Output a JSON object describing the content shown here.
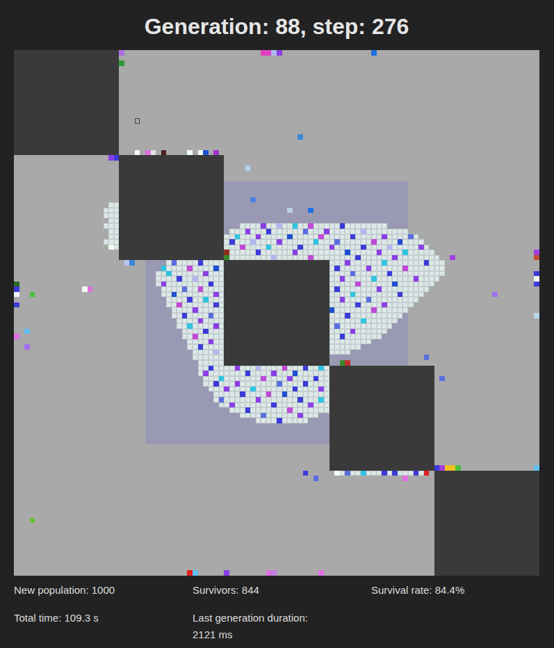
{
  "title": "Generation: 88, step: 276",
  "grid": {
    "size": 100,
    "obstacles": [
      [
        0,
        0,
        20,
        20
      ],
      [
        20,
        20,
        20,
        20
      ],
      [
        40,
        40,
        20,
        20
      ],
      [
        60,
        60,
        20,
        20
      ],
      [
        80,
        80,
        20,
        20
      ]
    ],
    "safe_zone": [
      25,
      25,
      50,
      50
    ],
    "marker": {
      "x": 23,
      "y": 13
    },
    "crowd": [
      [
        33,
        43,
        70
      ],
      [
        34,
        41,
        74
      ],
      [
        35,
        40,
        76
      ],
      [
        36,
        40,
        77
      ],
      [
        37,
        40,
        78
      ],
      [
        38,
        40,
        79
      ],
      [
        39,
        40,
        80
      ],
      [
        40,
        29,
        39
      ],
      [
        40,
        60,
        81
      ],
      [
        41,
        28,
        39
      ],
      [
        41,
        60,
        81
      ],
      [
        42,
        27,
        39
      ],
      [
        42,
        60,
        81
      ],
      [
        43,
        27,
        39
      ],
      [
        43,
        60,
        80
      ],
      [
        44,
        27,
        39
      ],
      [
        44,
        60,
        79
      ],
      [
        45,
        28,
        39
      ],
      [
        45,
        60,
        78
      ],
      [
        46,
        28,
        39
      ],
      [
        46,
        60,
        77
      ],
      [
        47,
        29,
        39
      ],
      [
        47,
        60,
        76
      ],
      [
        48,
        29,
        39
      ],
      [
        48,
        60,
        75
      ],
      [
        49,
        30,
        39
      ],
      [
        49,
        60,
        74
      ],
      [
        50,
        30,
        39
      ],
      [
        50,
        60,
        73
      ],
      [
        51,
        31,
        39
      ],
      [
        51,
        60,
        72
      ],
      [
        52,
        31,
        39
      ],
      [
        52,
        60,
        71
      ],
      [
        53,
        32,
        39
      ],
      [
        53,
        60,
        70
      ],
      [
        54,
        32,
        39
      ],
      [
        54,
        60,
        69
      ],
      [
        55,
        33,
        39
      ],
      [
        55,
        60,
        67
      ],
      [
        56,
        33,
        39
      ],
      [
        56,
        60,
        65
      ],
      [
        57,
        34,
        39
      ],
      [
        57,
        60,
        63
      ],
      [
        58,
        34,
        39
      ],
      [
        59,
        35,
        39
      ],
      [
        60,
        35,
        59
      ],
      [
        61,
        35,
        59
      ],
      [
        62,
        36,
        59
      ],
      [
        63,
        36,
        59
      ],
      [
        64,
        37,
        59
      ],
      [
        65,
        38,
        59
      ],
      [
        66,
        38,
        59
      ],
      [
        67,
        39,
        59
      ],
      [
        68,
        41,
        59
      ],
      [
        69,
        43,
        57
      ],
      [
        70,
        46,
        55
      ],
      [
        29,
        18,
        19
      ],
      [
        30,
        17,
        19
      ],
      [
        31,
        17,
        19
      ],
      [
        32,
        18,
        19
      ],
      [
        33,
        17,
        19
      ],
      [
        34,
        18,
        19
      ],
      [
        35,
        18,
        19
      ],
      [
        36,
        17,
        19
      ],
      [
        37,
        18,
        19
      ],
      [
        80,
        61,
        78
      ],
      [
        60,
        60,
        61
      ],
      [
        61,
        60,
        60
      ]
    ],
    "creatures": [
      [
        47,
        33,
        "#8a3fe6"
      ],
      [
        50,
        33,
        "#b0b8f0"
      ],
      [
        53,
        33,
        "#2fc4e0"
      ],
      [
        56,
        33,
        "#c04ad8"
      ],
      [
        62,
        33,
        "#3b3bd9"
      ],
      [
        44,
        34,
        "#8a3fe6"
      ],
      [
        48,
        34,
        "#3b3bd9"
      ],
      [
        55,
        34,
        "#5a6ee0"
      ],
      [
        59,
        34,
        "#8a3fe6"
      ],
      [
        66,
        34,
        "#b0b8f0"
      ],
      [
        42,
        35,
        "#2fc4e0"
      ],
      [
        46,
        35,
        "#8a3fe6"
      ],
      [
        52,
        35,
        "#1e4fd0"
      ],
      [
        58,
        35,
        "#c04ad8"
      ],
      [
        64,
        35,
        "#3b3bd9"
      ],
      [
        70,
        35,
        "#8a3fe6"
      ],
      [
        75,
        35,
        "#5a6ee0"
      ],
      [
        41,
        36,
        "#3b3bd9"
      ],
      [
        45,
        36,
        "#b0b8f0"
      ],
      [
        50,
        36,
        "#8a3fe6"
      ],
      [
        57,
        36,
        "#2fc4e0"
      ],
      [
        61,
        36,
        "#5a6ee0"
      ],
      [
        68,
        36,
        "#c04ad8"
      ],
      [
        73,
        36,
        "#1e4fd0"
      ],
      [
        43,
        37,
        "#c04ad8"
      ],
      [
        48,
        37,
        "#2fc4e0"
      ],
      [
        54,
        37,
        "#3b3bd9"
      ],
      [
        60,
        37,
        "#8a3fe6"
      ],
      [
        66,
        37,
        "#3b3bd9"
      ],
      [
        71,
        37,
        "#b0b8f0"
      ],
      [
        77,
        37,
        "#8a3fe6"
      ],
      [
        40,
        38,
        "#5a6ee0"
      ],
      [
        46,
        38,
        "#3b3bd9"
      ],
      [
        53,
        38,
        "#8a3fe6"
      ],
      [
        63,
        38,
        "#1e4fd0"
      ],
      [
        69,
        38,
        "#8a3fe6"
      ],
      [
        74,
        38,
        "#2fc4e0"
      ],
      [
        49,
        39,
        "#b0b8f0"
      ],
      [
        56,
        39,
        "#c04ad8"
      ],
      [
        65,
        39,
        "#3b3bd9"
      ],
      [
        72,
        39,
        "#8a3fe6"
      ],
      [
        30,
        40,
        "#5a6ee0"
      ],
      [
        35,
        40,
        "#3b3bd9"
      ],
      [
        63,
        40,
        "#8a3fe6"
      ],
      [
        70,
        40,
        "#2fc4e0"
      ],
      [
        78,
        40,
        "#3b3bd9"
      ],
      [
        33,
        41,
        "#c04ad8"
      ],
      [
        38,
        41,
        "#1e4fd0"
      ],
      [
        61,
        41,
        "#3b3bd9"
      ],
      [
        67,
        41,
        "#8a3fe6"
      ],
      [
        74,
        41,
        "#c04ad8"
      ],
      [
        29,
        42,
        "#2fc4e0"
      ],
      [
        36,
        42,
        "#8a3fe6"
      ],
      [
        64,
        42,
        "#5a6ee0"
      ],
      [
        71,
        42,
        "#3b3bd9"
      ],
      [
        31,
        43,
        "#3b3bd9"
      ],
      [
        34,
        43,
        "#b0b8f0"
      ],
      [
        62,
        43,
        "#8a3fe6"
      ],
      [
        68,
        43,
        "#2fc4e0"
      ],
      [
        76,
        43,
        "#8a3fe6"
      ],
      [
        28,
        44,
        "#8a3fe6"
      ],
      [
        37,
        44,
        "#3b3bd9"
      ],
      [
        65,
        44,
        "#c04ad8"
      ],
      [
        72,
        44,
        "#1e4fd0"
      ],
      [
        32,
        45,
        "#5a6ee0"
      ],
      [
        35,
        45,
        "#c04ad8"
      ],
      [
        61,
        45,
        "#3b3bd9"
      ],
      [
        69,
        45,
        "#8a3fe6"
      ],
      [
        30,
        46,
        "#1e4fd0"
      ],
      [
        38,
        46,
        "#8a3fe6"
      ],
      [
        64,
        46,
        "#2fc4e0"
      ],
      [
        73,
        46,
        "#3b3bd9"
      ],
      [
        33,
        47,
        "#3b3bd9"
      ],
      [
        36,
        47,
        "#2fc4e0"
      ],
      [
        62,
        47,
        "#8a3fe6"
      ],
      [
        67,
        47,
        "#5a6ee0"
      ],
      [
        31,
        48,
        "#c04ad8"
      ],
      [
        38,
        48,
        "#3b3bd9"
      ],
      [
        65,
        48,
        "#3b3bd9"
      ],
      [
        70,
        48,
        "#8a3fe6"
      ],
      [
        34,
        49,
        "#8a3fe6"
      ],
      [
        60,
        49,
        "#1e4fd0"
      ],
      [
        68,
        49,
        "#c04ad8"
      ],
      [
        32,
        50,
        "#3b3bd9"
      ],
      [
        37,
        50,
        "#5a6ee0"
      ],
      [
        63,
        50,
        "#3b3bd9"
      ],
      [
        35,
        51,
        "#8a3fe6"
      ],
      [
        66,
        51,
        "#2fc4e0"
      ],
      [
        33,
        52,
        "#2fc4e0"
      ],
      [
        38,
        52,
        "#8a3fe6"
      ],
      [
        61,
        52,
        "#5a6ee0"
      ],
      [
        36,
        53,
        "#3b3bd9"
      ],
      [
        64,
        53,
        "#8a3fe6"
      ],
      [
        34,
        54,
        "#c04ad8"
      ],
      [
        62,
        54,
        "#3b3bd9"
      ],
      [
        37,
        55,
        "#8a3fe6"
      ],
      [
        35,
        56,
        "#3b3bd9"
      ],
      [
        38,
        57,
        "#b0b8f0"
      ],
      [
        37,
        60,
        "#3b3bd9"
      ],
      [
        42,
        60,
        "#8a3fe6"
      ],
      [
        46,
        60,
        "#b0b8f0"
      ],
      [
        51,
        60,
        "#c04ad8"
      ],
      [
        55,
        60,
        "#3b3bd9"
      ],
      [
        58,
        60,
        "#2fc4e0"
      ],
      [
        36,
        61,
        "#8a3fe6"
      ],
      [
        44,
        61,
        "#3b3bd9"
      ],
      [
        49,
        61,
        "#8a3fe6"
      ],
      [
        53,
        61,
        "#1e4fd0"
      ],
      [
        39,
        62,
        "#2fc4e0"
      ],
      [
        47,
        62,
        "#c04ad8"
      ],
      [
        52,
        62,
        "#8a3fe6"
      ],
      [
        57,
        62,
        "#3b3bd9"
      ],
      [
        38,
        63,
        "#3b3bd9"
      ],
      [
        42,
        63,
        "#8a3fe6"
      ],
      [
        50,
        63,
        "#5a6ee0"
      ],
      [
        55,
        63,
        "#3b3bd9"
      ],
      [
        40,
        64,
        "#8a3fe6"
      ],
      [
        45,
        64,
        "#2fc4e0"
      ],
      [
        53,
        64,
        "#3b3bd9"
      ],
      [
        58,
        64,
        "#8a3fe6"
      ],
      [
        43,
        65,
        "#3b3bd9"
      ],
      [
        48,
        65,
        "#c04ad8"
      ],
      [
        51,
        65,
        "#1e4fd0"
      ],
      [
        39,
        66,
        "#5a6ee0"
      ],
      [
        46,
        66,
        "#8a3fe6"
      ],
      [
        54,
        66,
        "#3b3bd9"
      ],
      [
        58,
        66,
        "#2fc4e0"
      ],
      [
        41,
        67,
        "#8a3fe6"
      ],
      [
        49,
        67,
        "#3b3bd9"
      ],
      [
        56,
        67,
        "#8a3fe6"
      ],
      [
        44,
        68,
        "#3b3bd9"
      ],
      [
        52,
        68,
        "#c04ad8"
      ],
      [
        47,
        69,
        "#5a6ee0"
      ],
      [
        54,
        69,
        "#8a3fe6"
      ],
      [
        50,
        70,
        "#3b3bd9"
      ],
      [
        47,
        0,
        "#e040c0"
      ],
      [
        48,
        0,
        "#e040c0"
      ],
      [
        49,
        0,
        "#b0b8f0"
      ],
      [
        50,
        0,
        "#8a3fe6"
      ],
      [
        68,
        0,
        "#1e6fe0"
      ],
      [
        20,
        0,
        "#b070e0"
      ],
      [
        20,
        2,
        "#2a9a3a"
      ],
      [
        23,
        19,
        "#f0fff0"
      ],
      [
        25,
        19,
        "#e070e0"
      ],
      [
        26,
        19,
        "#dde8f0"
      ],
      [
        28,
        19,
        "#4a2020"
      ],
      [
        33,
        19,
        "#f0fff0"
      ],
      [
        35,
        19,
        "#f0fff0"
      ],
      [
        36,
        19,
        "#1e4fd0"
      ],
      [
        38,
        19,
        "#a030d0"
      ],
      [
        18,
        20,
        "#8a3fe6"
      ],
      [
        19,
        20,
        "#3b3bd9"
      ],
      [
        54,
        16,
        "#3b88d8"
      ],
      [
        44,
        22,
        "#b8d0e8"
      ],
      [
        45,
        28,
        "#4a80e0"
      ],
      [
        56,
        30,
        "#1e6fe0"
      ],
      [
        52,
        30,
        "#b8d0e8"
      ],
      [
        0,
        44,
        "#2a6a2a"
      ],
      [
        0,
        45,
        "#3b3bd9"
      ],
      [
        0,
        46,
        "#f0f8ff"
      ],
      [
        0,
        48,
        "#3b3bd9"
      ],
      [
        3,
        46,
        "#4ac040"
      ],
      [
        13,
        45,
        "#f0fff0"
      ],
      [
        14,
        45,
        "#e070e0"
      ],
      [
        2,
        53,
        "#60c0f0"
      ],
      [
        0,
        54,
        "#e070e0"
      ],
      [
        2,
        56,
        "#a070f0"
      ],
      [
        3,
        89,
        "#6ac030"
      ],
      [
        99,
        38,
        "#a040e0"
      ],
      [
        99,
        39,
        "#c05030"
      ],
      [
        99,
        42,
        "#3b3bd9"
      ],
      [
        99,
        43,
        "#f0fff0"
      ],
      [
        99,
        44,
        "#3b3bd9"
      ],
      [
        99,
        50,
        "#b8d8e8"
      ],
      [
        91,
        46,
        "#a070f0"
      ],
      [
        81,
        62,
        "#5a6ee0"
      ],
      [
        78,
        58,
        "#5a6ee0"
      ],
      [
        83,
        39,
        "#a040e0"
      ],
      [
        33,
        99,
        "#e02020"
      ],
      [
        34,
        99,
        "#60c0f0"
      ],
      [
        40,
        99,
        "#8a3fe6"
      ],
      [
        48,
        99,
        "#e070e0"
      ],
      [
        49,
        99,
        "#c080e0"
      ],
      [
        58,
        99,
        "#e070e0"
      ],
      [
        55,
        80,
        "#3b3bd9"
      ],
      [
        57,
        81,
        "#5a6ee0"
      ],
      [
        61,
        80,
        "#f0fff0"
      ],
      [
        63,
        80,
        "#5a6ee0"
      ],
      [
        66,
        80,
        "#2fc4e0"
      ],
      [
        70,
        80,
        "#3b3bd9"
      ],
      [
        72,
        80,
        "#3b3bd9"
      ],
      [
        74,
        81,
        "#e070e0"
      ],
      [
        76,
        80,
        "#3b3bd9"
      ],
      [
        78,
        80,
        "#e02020"
      ],
      [
        80,
        79,
        "#3b3bd9"
      ],
      [
        81,
        79,
        "#a040e0"
      ],
      [
        82,
        79,
        "#f0c020"
      ],
      [
        83,
        79,
        "#f0c020"
      ],
      [
        84,
        79,
        "#4ac040"
      ],
      [
        99,
        79,
        "#60c0f0"
      ],
      [
        62,
        59,
        "#3a8a2a"
      ],
      [
        63,
        59,
        "#c03030"
      ],
      [
        18,
        37,
        "#f0fff0"
      ],
      [
        21,
        40,
        "#b8c8f0"
      ],
      [
        22,
        40,
        "#3b88d8"
      ],
      [
        28,
        41,
        "#2fc4e0"
      ],
      [
        40,
        39,
        "#3a8a2a"
      ],
      [
        40,
        38,
        "#8a3020"
      ]
    ]
  },
  "stats": [
    {
      "lines": [
        "New population: 1000"
      ]
    },
    {
      "lines": [
        "Survivors: 844"
      ]
    },
    {
      "lines": [
        "Survival rate: 84.4%"
      ]
    },
    {
      "lines": [
        "Total time: 109.3 s"
      ]
    },
    {
      "lines": [
        "Last generation duration:",
        "2121 ms"
      ]
    }
  ]
}
